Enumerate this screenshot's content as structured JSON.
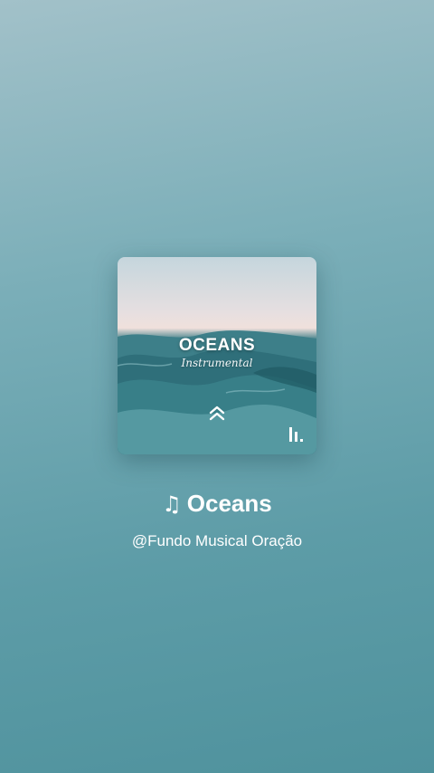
{
  "album": {
    "title": "OCEANS",
    "subtitle": "Instrumental",
    "icons": [
      "chevron-up-double-icon",
      "brand-logo-icon"
    ]
  },
  "track": {
    "note_glyph": "♫",
    "title": "Oceans"
  },
  "artist": {
    "handle": "@Fundo Musical Oração"
  },
  "colors": {
    "background_top": "#a2c1c9",
    "background_bottom": "#4f929d",
    "text": "#ffffff"
  }
}
